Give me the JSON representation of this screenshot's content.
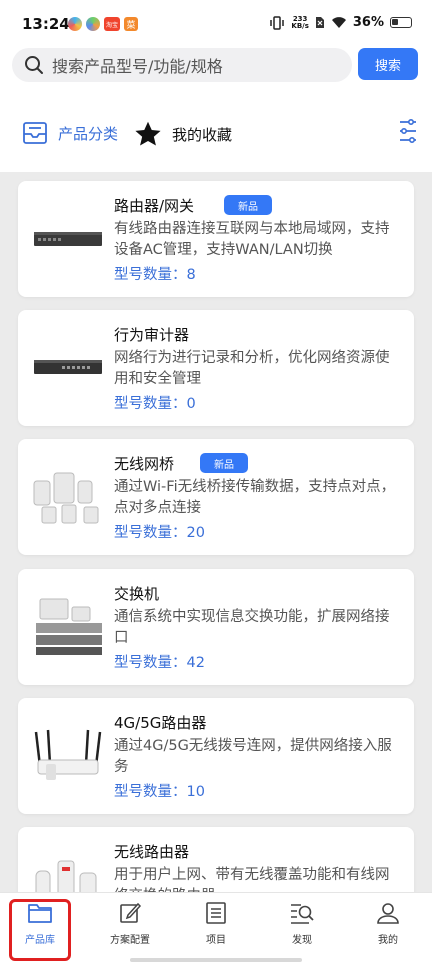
{
  "status_bar": {
    "time": "13:24",
    "net_speed_value": "233",
    "net_speed_unit": "KB/s",
    "battery": "36%",
    "app_badge_text": "淘宝",
    "app_badge_text2": "菜"
  },
  "search": {
    "placeholder": "搜索产品型号/功能/规格",
    "button_label": "搜索"
  },
  "tabs": {
    "category": "产品分类",
    "favorites": "我的收藏"
  },
  "products": [
    {
      "name": "路由器/网关",
      "badge": "新品",
      "desc": "有线路由器连接互联网与本地局域网，支持设备AC管理，支持WAN/LAN切换",
      "count": "型号数量：8",
      "icon": "router-gateway-icon"
    },
    {
      "name": "行为审计器",
      "badge": "",
      "desc": "网络行为进行记录和分析，优化网络资源使用和安全管理",
      "count": "型号数量：0",
      "icon": "audit-device-icon"
    },
    {
      "name": "无线网桥",
      "badge": "新品",
      "desc": "通过Wi-Fi无线桥接传输数据，支持点对点，点对多点连接",
      "count": "型号数量：20",
      "icon": "wireless-bridge-icon"
    },
    {
      "name": "交换机",
      "badge": "",
      "desc": "通信系统中实现信息交换功能，扩展网络接口",
      "count": "型号数量：42",
      "icon": "switch-icon"
    },
    {
      "name": "4G/5G路由器",
      "badge": "",
      "desc": "通过4G/5G无线拨号连网，提供网络接入服务",
      "count": "型号数量：10",
      "icon": "cellular-router-icon"
    },
    {
      "name": "无线路由器",
      "badge": "",
      "desc": "用于用户上网、带有无线覆盖功能和有线网络交换的路由器",
      "count": "",
      "icon": "wireless-router-icon"
    }
  ],
  "bottom_nav": [
    {
      "label": "产品库",
      "icon": "folder-icon",
      "active": true
    },
    {
      "label": "方案配置",
      "icon": "edit-icon",
      "active": false
    },
    {
      "label": "项目",
      "icon": "document-icon",
      "active": false
    },
    {
      "label": "发现",
      "icon": "discover-search-icon",
      "active": false
    },
    {
      "label": "我的",
      "icon": "user-icon",
      "active": false
    }
  ],
  "colors": {
    "accent": "#3478f6",
    "link_blue": "#3a6fd8",
    "highlight_red": "#e02020"
  }
}
